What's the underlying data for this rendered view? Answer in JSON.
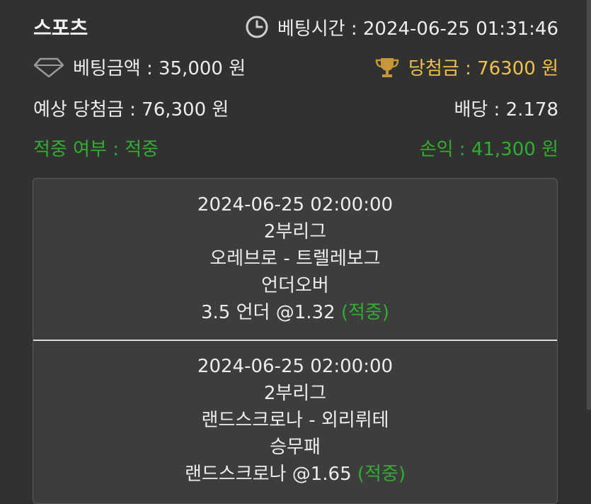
{
  "header": {
    "title": "스포츠",
    "bet_time": "베팅시간 : 2024-06-25 01:31:46",
    "bet_amount": "베팅금액 : 35,000 원",
    "win_amount": "당첨금 : 76300 원",
    "expected_win": "예상 당첨금 : 76,300 원",
    "odds": "배당 : 2.178",
    "hit_status": "적중 여부 : 적중",
    "profit": "손익 : 41,300 원"
  },
  "bets": [
    {
      "datetime": "2024-06-25 02:00:00",
      "league": "2부리그",
      "match": "오레브로 - 트렐레보그",
      "market": "언더오버",
      "pick": "3.5 언더 @1.32",
      "result": "(적중)"
    },
    {
      "datetime": "2024-06-25 02:00:00",
      "league": "2부리그",
      "match": "랜드스크로나 - 외리뤼테",
      "market": "승무패",
      "pick": "랜드스크로나 @1.65",
      "result": "(적중)"
    }
  ],
  "icons": {
    "clock": "clock-icon",
    "diamond": "diamond-icon",
    "trophy": "trophy-icon"
  },
  "colors": {
    "green": "#2fae2f",
    "gold": "#f0c04a",
    "background": "#313131"
  }
}
